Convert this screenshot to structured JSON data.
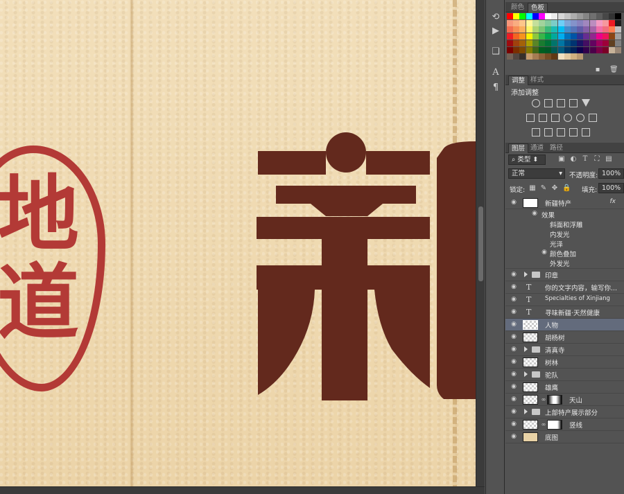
{
  "canvas": {
    "stamp_chars": [
      "地",
      "道"
    ],
    "stamp_color": "#b33a36",
    "glyph_color": "#63291d",
    "background_color": "#efd9b1"
  },
  "toolstrip": {
    "icons": [
      "history-icon",
      "play-icon",
      "layer-comps-icon",
      "character-icon",
      "paragraph-icon"
    ]
  },
  "swatch_panel": {
    "tabs": [
      "颜色",
      "色板"
    ],
    "active_tab": "色板"
  },
  "adjust_panel": {
    "tabs": [
      "调整",
      "样式"
    ],
    "active_tab": "调整",
    "title": "添加调整"
  },
  "layers_panel": {
    "tabs": [
      "图层",
      "通道",
      "路径"
    ],
    "active_tab": "图层",
    "filter_label": "类型",
    "blend_mode": "正常",
    "opacity_label": "不透明度:",
    "opacity_value": "100%",
    "lock_label": "锁定:",
    "fill_label": "填充:",
    "fill_value": "100%",
    "layers": [
      {
        "name": "新疆特产",
        "kind": "text-fx"
      },
      {
        "name": "效果",
        "kind": "effects-header"
      },
      {
        "name": "斜面和浮雕",
        "kind": "effect"
      },
      {
        "name": "内发光",
        "kind": "effect"
      },
      {
        "name": "光泽",
        "kind": "effect"
      },
      {
        "name": "颜色叠加",
        "kind": "effect-visible"
      },
      {
        "name": "外发光",
        "kind": "effect"
      },
      {
        "name": "印章",
        "kind": "group"
      },
      {
        "name": "你的文字内容，输写你...",
        "kind": "text"
      },
      {
        "name": "Specialties of Xinjiang",
        "kind": "text"
      },
      {
        "name": "寻味新疆·天然健康",
        "kind": "text"
      },
      {
        "name": "人物",
        "kind": "pixel-selected"
      },
      {
        "name": "胡杨树",
        "kind": "pixel"
      },
      {
        "name": "清真寺",
        "kind": "group"
      },
      {
        "name": "树林",
        "kind": "pixel"
      },
      {
        "name": "驼队",
        "kind": "group"
      },
      {
        "name": "雄鹰",
        "kind": "pixel"
      },
      {
        "name": "天山",
        "kind": "masked"
      },
      {
        "name": "上部特产展示部分",
        "kind": "group"
      },
      {
        "name": "竖线",
        "kind": "masked"
      },
      {
        "name": "底图",
        "kind": "fill"
      }
    ]
  }
}
